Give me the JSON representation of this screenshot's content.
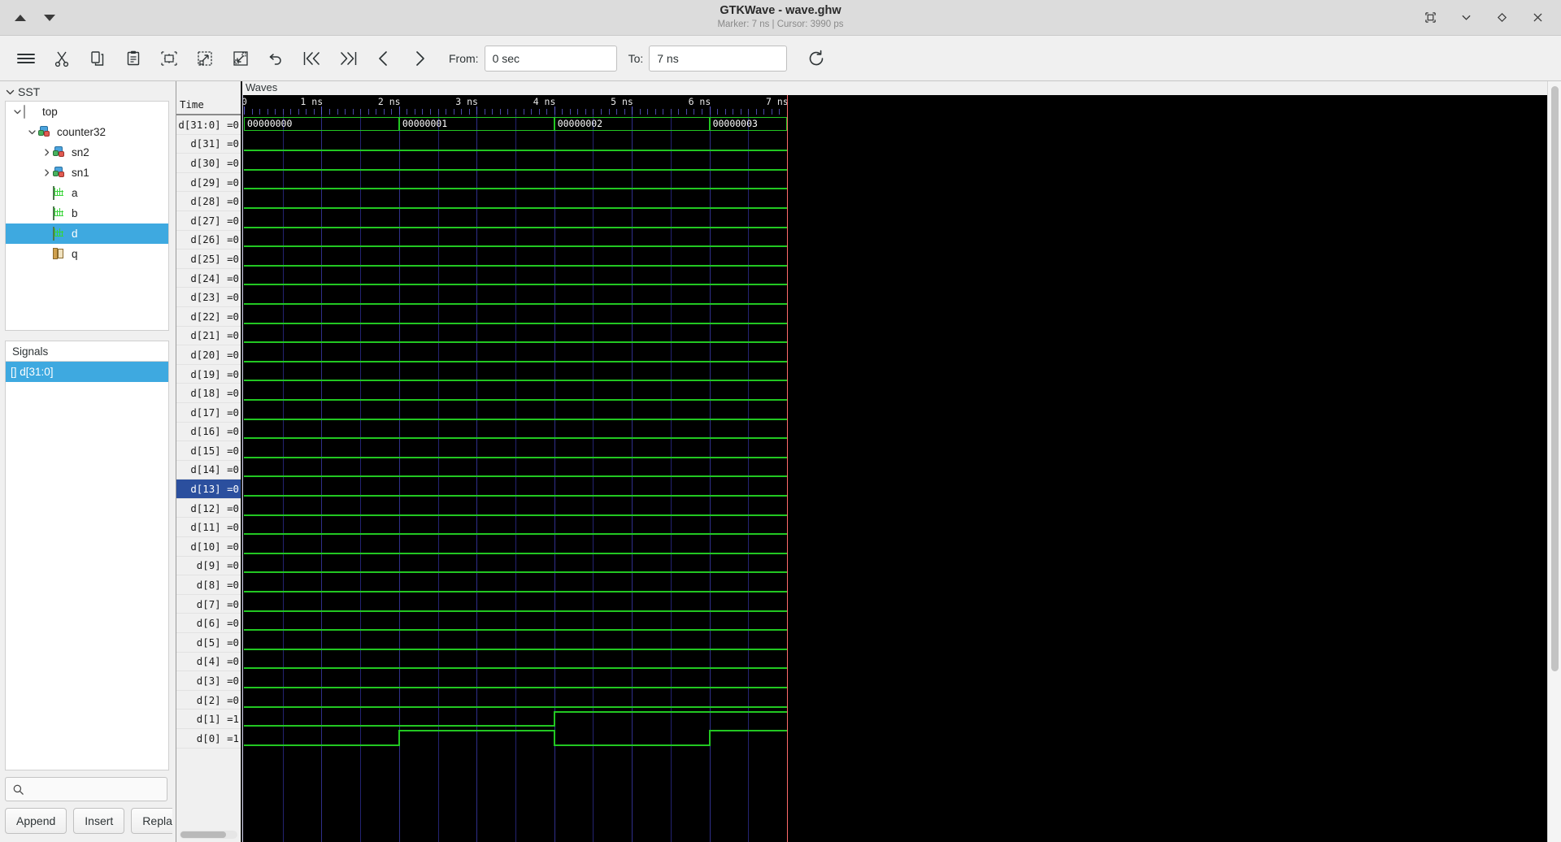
{
  "window": {
    "title": "GTKWave - wave.ghw",
    "subtitle": "Marker: 7 ns  |  Cursor: 3990 ps",
    "marker": "Marker: 7 ns",
    "cursor": "Cursor: 3990 ps",
    "controls": [
      {
        "name": "restore-icon",
        "glyph": "⧉"
      },
      {
        "name": "minimize-icon",
        "glyph": "⌄"
      },
      {
        "name": "maximize-icon",
        "glyph": "◇"
      },
      {
        "name": "close-icon",
        "glyph": "✕"
      }
    ],
    "nav_up": "▲",
    "nav_down": "▼"
  },
  "toolbar": {
    "buttons": [
      {
        "name": "menu-icon",
        "tip": "Menu"
      },
      {
        "name": "cut-icon",
        "tip": "Cut"
      },
      {
        "name": "copy-icon",
        "tip": "Copy"
      },
      {
        "name": "paste-icon",
        "tip": "Paste"
      },
      {
        "name": "zoom-fit-icon",
        "tip": "Zoom Fit"
      },
      {
        "name": "zoom-out-icon",
        "tip": "Zoom Out"
      },
      {
        "name": "zoom-in-icon",
        "tip": "Zoom In"
      },
      {
        "name": "undo-icon",
        "tip": "Zoom Undo"
      },
      {
        "name": "go-start-icon",
        "tip": "Go To Start"
      },
      {
        "name": "go-end-icon",
        "tip": "Go To End"
      },
      {
        "name": "prev-edge-icon",
        "tip": "Previous Edge"
      },
      {
        "name": "next-edge-icon",
        "tip": "Next Edge"
      },
      {
        "name": "reload-icon",
        "tip": "Reload"
      }
    ],
    "from_label": "From:",
    "from_value": "0 sec",
    "to_label": "To:",
    "to_value": "7 ns"
  },
  "sst": {
    "header": "SST",
    "tree": [
      {
        "label": "top",
        "depth": 0,
        "icon": "module-icon",
        "expander": "down",
        "selected": false
      },
      {
        "label": "counter32",
        "depth": 1,
        "icon": "instance-icon",
        "expander": "down",
        "selected": false
      },
      {
        "label": "sn2",
        "depth": 2,
        "icon": "instance-icon",
        "expander": "right",
        "selected": false
      },
      {
        "label": "sn1",
        "depth": 2,
        "icon": "instance-icon",
        "expander": "right",
        "selected": false
      },
      {
        "label": "a",
        "depth": 2,
        "icon": "wave-icon",
        "expander": "none",
        "selected": false
      },
      {
        "label": "b",
        "depth": 2,
        "icon": "wave-icon",
        "expander": "none",
        "selected": false
      },
      {
        "label": "d",
        "depth": 2,
        "icon": "wave-icon",
        "expander": "none",
        "selected": true
      },
      {
        "label": "q",
        "depth": 2,
        "icon": "port-icon",
        "expander": "none",
        "selected": false
      }
    ]
  },
  "signals_panel": {
    "header": "Signals",
    "items": [
      {
        "label": "[] d[31:0]",
        "selected": true
      }
    ]
  },
  "search": {
    "placeholder": "",
    "value": "",
    "icon": "search-icon"
  },
  "actions": {
    "append": "Append",
    "insert": "Insert",
    "replace": "Replace"
  },
  "wave_panel": {
    "label": "Waves",
    "names_header": "Time",
    "signals": [
      {
        "name": "d[31:0]",
        "value": "0",
        "display": "d[31:0] =0",
        "selected": false,
        "type": "bus"
      },
      {
        "name": "d[31]",
        "value": "0",
        "display": "d[31] =0",
        "selected": false,
        "type": "bit"
      },
      {
        "name": "d[30]",
        "value": "0",
        "display": "d[30] =0",
        "selected": false,
        "type": "bit"
      },
      {
        "name": "d[29]",
        "value": "0",
        "display": "d[29] =0",
        "selected": false,
        "type": "bit"
      },
      {
        "name": "d[28]",
        "value": "0",
        "display": "d[28] =0",
        "selected": false,
        "type": "bit"
      },
      {
        "name": "d[27]",
        "value": "0",
        "display": "d[27] =0",
        "selected": false,
        "type": "bit"
      },
      {
        "name": "d[26]",
        "value": "0",
        "display": "d[26] =0",
        "selected": false,
        "type": "bit"
      },
      {
        "name": "d[25]",
        "value": "0",
        "display": "d[25] =0",
        "selected": false,
        "type": "bit"
      },
      {
        "name": "d[24]",
        "value": "0",
        "display": "d[24] =0",
        "selected": false,
        "type": "bit"
      },
      {
        "name": "d[23]",
        "value": "0",
        "display": "d[23] =0",
        "selected": false,
        "type": "bit"
      },
      {
        "name": "d[22]",
        "value": "0",
        "display": "d[22] =0",
        "selected": false,
        "type": "bit"
      },
      {
        "name": "d[21]",
        "value": "0",
        "display": "d[21] =0",
        "selected": false,
        "type": "bit"
      },
      {
        "name": "d[20]",
        "value": "0",
        "display": "d[20] =0",
        "selected": false,
        "type": "bit"
      },
      {
        "name": "d[19]",
        "value": "0",
        "display": "d[19] =0",
        "selected": false,
        "type": "bit"
      },
      {
        "name": "d[18]",
        "value": "0",
        "display": "d[18] =0",
        "selected": false,
        "type": "bit"
      },
      {
        "name": "d[17]",
        "value": "0",
        "display": "d[17] =0",
        "selected": false,
        "type": "bit"
      },
      {
        "name": "d[16]",
        "value": "0",
        "display": "d[16] =0",
        "selected": false,
        "type": "bit"
      },
      {
        "name": "d[15]",
        "value": "0",
        "display": "d[15] =0",
        "selected": false,
        "type": "bit"
      },
      {
        "name": "d[14]",
        "value": "0",
        "display": "d[14] =0",
        "selected": false,
        "type": "bit"
      },
      {
        "name": "d[13]",
        "value": "0",
        "display": "d[13] =0",
        "selected": true,
        "type": "bit"
      },
      {
        "name": "d[12]",
        "value": "0",
        "display": "d[12] =0",
        "selected": false,
        "type": "bit"
      },
      {
        "name": "d[11]",
        "value": "0",
        "display": "d[11] =0",
        "selected": false,
        "type": "bit"
      },
      {
        "name": "d[10]",
        "value": "0",
        "display": "d[10] =0",
        "selected": false,
        "type": "bit"
      },
      {
        "name": "d[9]",
        "value": "0",
        "display": "d[9] =0",
        "selected": false,
        "type": "bit"
      },
      {
        "name": "d[8]",
        "value": "0",
        "display": "d[8] =0",
        "selected": false,
        "type": "bit"
      },
      {
        "name": "d[7]",
        "value": "0",
        "display": "d[7] =0",
        "selected": false,
        "type": "bit"
      },
      {
        "name": "d[6]",
        "value": "0",
        "display": "d[6] =0",
        "selected": false,
        "type": "bit"
      },
      {
        "name": "d[5]",
        "value": "0",
        "display": "d[5] =0",
        "selected": false,
        "type": "bit"
      },
      {
        "name": "d[4]",
        "value": "0",
        "display": "d[4] =0",
        "selected": false,
        "type": "bit"
      },
      {
        "name": "d[3]",
        "value": "0",
        "display": "d[3] =0",
        "selected": false,
        "type": "bit"
      },
      {
        "name": "d[2]",
        "value": "0",
        "display": "d[2] =0",
        "selected": false,
        "type": "bit"
      },
      {
        "name": "d[1]",
        "value": "1",
        "display": "d[1] =1",
        "selected": false,
        "type": "bit"
      },
      {
        "name": "d[0]",
        "value": "1",
        "display": "d[0] =1",
        "selected": false,
        "type": "bit"
      }
    ]
  },
  "chart_data": {
    "type": "timing-diagram",
    "title": "Waves",
    "xlabel": "Time",
    "time_unit": "ns",
    "xlim": [
      0,
      7
    ],
    "grid": true,
    "tick_labels": [
      "0",
      "1 ns",
      "2 ns",
      "3 ns",
      "4 ns",
      "5 ns",
      "6 ns",
      "7 ns"
    ],
    "tick_values": [
      0,
      1,
      2,
      3,
      4,
      5,
      6,
      7
    ],
    "minor_ticks_per_major": 10,
    "marker_ns": 7,
    "cursor_ps": 3990,
    "colors": {
      "background": "#000000",
      "signal": "#22c722",
      "grid": "#2f2f8a",
      "cursor": "#ff6b6b",
      "marker": "#cfcfe8",
      "text": "#ffffff"
    },
    "series": [
      {
        "name": "d[31:0]",
        "kind": "bus",
        "segments": [
          {
            "start_ns": 0,
            "end_ns": 2,
            "value": "00000000"
          },
          {
            "start_ns": 2,
            "end_ns": 4,
            "value": "00000001"
          },
          {
            "start_ns": 4,
            "end_ns": 6,
            "value": "00000002"
          },
          {
            "start_ns": 6,
            "end_ns": 7,
            "value": "00000003"
          }
        ]
      },
      {
        "name": "d[31]",
        "kind": "bit",
        "transitions": [
          {
            "t_ns": 0,
            "v": 0
          }
        ]
      },
      {
        "name": "d[30]",
        "kind": "bit",
        "transitions": [
          {
            "t_ns": 0,
            "v": 0
          }
        ]
      },
      {
        "name": "d[29]",
        "kind": "bit",
        "transitions": [
          {
            "t_ns": 0,
            "v": 0
          }
        ]
      },
      {
        "name": "d[28]",
        "kind": "bit",
        "transitions": [
          {
            "t_ns": 0,
            "v": 0
          }
        ]
      },
      {
        "name": "d[27]",
        "kind": "bit",
        "transitions": [
          {
            "t_ns": 0,
            "v": 0
          }
        ]
      },
      {
        "name": "d[26]",
        "kind": "bit",
        "transitions": [
          {
            "t_ns": 0,
            "v": 0
          }
        ]
      },
      {
        "name": "d[25]",
        "kind": "bit",
        "transitions": [
          {
            "t_ns": 0,
            "v": 0
          }
        ]
      },
      {
        "name": "d[24]",
        "kind": "bit",
        "transitions": [
          {
            "t_ns": 0,
            "v": 0
          }
        ]
      },
      {
        "name": "d[23]",
        "kind": "bit",
        "transitions": [
          {
            "t_ns": 0,
            "v": 0
          }
        ]
      },
      {
        "name": "d[22]",
        "kind": "bit",
        "transitions": [
          {
            "t_ns": 0,
            "v": 0
          }
        ]
      },
      {
        "name": "d[21]",
        "kind": "bit",
        "transitions": [
          {
            "t_ns": 0,
            "v": 0
          }
        ]
      },
      {
        "name": "d[20]",
        "kind": "bit",
        "transitions": [
          {
            "t_ns": 0,
            "v": 0
          }
        ]
      },
      {
        "name": "d[19]",
        "kind": "bit",
        "transitions": [
          {
            "t_ns": 0,
            "v": 0
          }
        ]
      },
      {
        "name": "d[18]",
        "kind": "bit",
        "transitions": [
          {
            "t_ns": 0,
            "v": 0
          }
        ]
      },
      {
        "name": "d[17]",
        "kind": "bit",
        "transitions": [
          {
            "t_ns": 0,
            "v": 0
          }
        ]
      },
      {
        "name": "d[16]",
        "kind": "bit",
        "transitions": [
          {
            "t_ns": 0,
            "v": 0
          }
        ]
      },
      {
        "name": "d[15]",
        "kind": "bit",
        "transitions": [
          {
            "t_ns": 0,
            "v": 0
          }
        ]
      },
      {
        "name": "d[14]",
        "kind": "bit",
        "transitions": [
          {
            "t_ns": 0,
            "v": 0
          }
        ]
      },
      {
        "name": "d[13]",
        "kind": "bit",
        "transitions": [
          {
            "t_ns": 0,
            "v": 0
          }
        ]
      },
      {
        "name": "d[12]",
        "kind": "bit",
        "transitions": [
          {
            "t_ns": 0,
            "v": 0
          }
        ]
      },
      {
        "name": "d[11]",
        "kind": "bit",
        "transitions": [
          {
            "t_ns": 0,
            "v": 0
          }
        ]
      },
      {
        "name": "d[10]",
        "kind": "bit",
        "transitions": [
          {
            "t_ns": 0,
            "v": 0
          }
        ]
      },
      {
        "name": "d[9]",
        "kind": "bit",
        "transitions": [
          {
            "t_ns": 0,
            "v": 0
          }
        ]
      },
      {
        "name": "d[8]",
        "kind": "bit",
        "transitions": [
          {
            "t_ns": 0,
            "v": 0
          }
        ]
      },
      {
        "name": "d[7]",
        "kind": "bit",
        "transitions": [
          {
            "t_ns": 0,
            "v": 0
          }
        ]
      },
      {
        "name": "d[6]",
        "kind": "bit",
        "transitions": [
          {
            "t_ns": 0,
            "v": 0
          }
        ]
      },
      {
        "name": "d[5]",
        "kind": "bit",
        "transitions": [
          {
            "t_ns": 0,
            "v": 0
          }
        ]
      },
      {
        "name": "d[4]",
        "kind": "bit",
        "transitions": [
          {
            "t_ns": 0,
            "v": 0
          }
        ]
      },
      {
        "name": "d[3]",
        "kind": "bit",
        "transitions": [
          {
            "t_ns": 0,
            "v": 0
          }
        ]
      },
      {
        "name": "d[2]",
        "kind": "bit",
        "transitions": [
          {
            "t_ns": 0,
            "v": 0
          }
        ]
      },
      {
        "name": "d[1]",
        "kind": "bit",
        "transitions": [
          {
            "t_ns": 0,
            "v": 0
          },
          {
            "t_ns": 4,
            "v": 1
          }
        ]
      },
      {
        "name": "d[0]",
        "kind": "bit",
        "transitions": [
          {
            "t_ns": 0,
            "v": 0
          },
          {
            "t_ns": 2,
            "v": 1
          },
          {
            "t_ns": 4,
            "v": 0
          },
          {
            "t_ns": 6,
            "v": 1
          }
        ]
      }
    ]
  }
}
